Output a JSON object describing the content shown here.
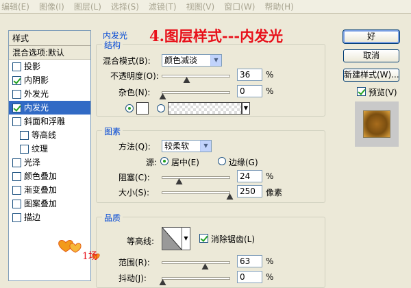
{
  "menubar": {
    "items": [
      "编辑(E)",
      "图像(I)",
      "图层(L)",
      "选择(S)",
      "滤镜(T)",
      "视图(V)",
      "窗口(W)",
      "帮助(H)"
    ]
  },
  "overlay_title": "4.图层样式---内发光",
  "styles_panel": {
    "header": "样式",
    "blend_options": "混合选项:默认",
    "items": [
      {
        "label": "投影",
        "checked": false,
        "sub": false,
        "selected": false
      },
      {
        "label": "内阴影",
        "checked": true,
        "sub": false,
        "selected": false
      },
      {
        "label": "外发光",
        "checked": false,
        "sub": false,
        "selected": false
      },
      {
        "label": "内发光",
        "checked": true,
        "sub": false,
        "selected": true
      },
      {
        "label": "斜面和浮雕",
        "checked": false,
        "sub": false,
        "selected": false
      },
      {
        "label": "等高线",
        "checked": false,
        "sub": true,
        "selected": false
      },
      {
        "label": "纹理",
        "checked": false,
        "sub": true,
        "selected": false
      },
      {
        "label": "光泽",
        "checked": false,
        "sub": false,
        "selected": false
      },
      {
        "label": "颜色叠加",
        "checked": false,
        "sub": false,
        "selected": false
      },
      {
        "label": "渐变叠加",
        "checked": false,
        "sub": false,
        "selected": false
      },
      {
        "label": "图案叠加",
        "checked": false,
        "sub": false,
        "selected": false
      },
      {
        "label": "描边",
        "checked": false,
        "sub": false,
        "selected": false
      }
    ]
  },
  "inner_glow": {
    "title": "内发光",
    "structure": {
      "legend": "结构",
      "blend_mode_label": "混合模式(B):",
      "blend_mode_value": "颜色减淡",
      "opacity_label": "不透明度(O):",
      "opacity_value": "36",
      "opacity_fraction": 0.36,
      "noise_label": "杂色(N):",
      "noise_value": "0",
      "noise_fraction": 0.0,
      "percent": "%"
    },
    "elements": {
      "legend": "图素",
      "method_label": "方法(Q):",
      "method_value": "较柔软",
      "source_label": "源:",
      "source_center": "居中(E)",
      "source_edge": "边缘(G)",
      "choke_label": "阻塞(C):",
      "choke_value": "24",
      "choke_fraction": 0.24,
      "size_label": "大小(S):",
      "size_value": "250",
      "size_fraction": 1.0,
      "size_unit": "像素",
      "percent": "%"
    },
    "quality": {
      "legend": "品质",
      "contour_label": "等高线:",
      "antialias_label": "消除锯齿(L)",
      "range_label": "范围(R):",
      "range_value": "63",
      "range_fraction": 0.63,
      "jitter_label": "抖动(J):",
      "jitter_value": "0",
      "jitter_fraction": 0.0,
      "percent": "%"
    }
  },
  "buttons": {
    "ok": "好",
    "cancel": "取消",
    "new_style": "新建样式(W)...",
    "preview": "预览(V)"
  },
  "logo_text": "1场"
}
